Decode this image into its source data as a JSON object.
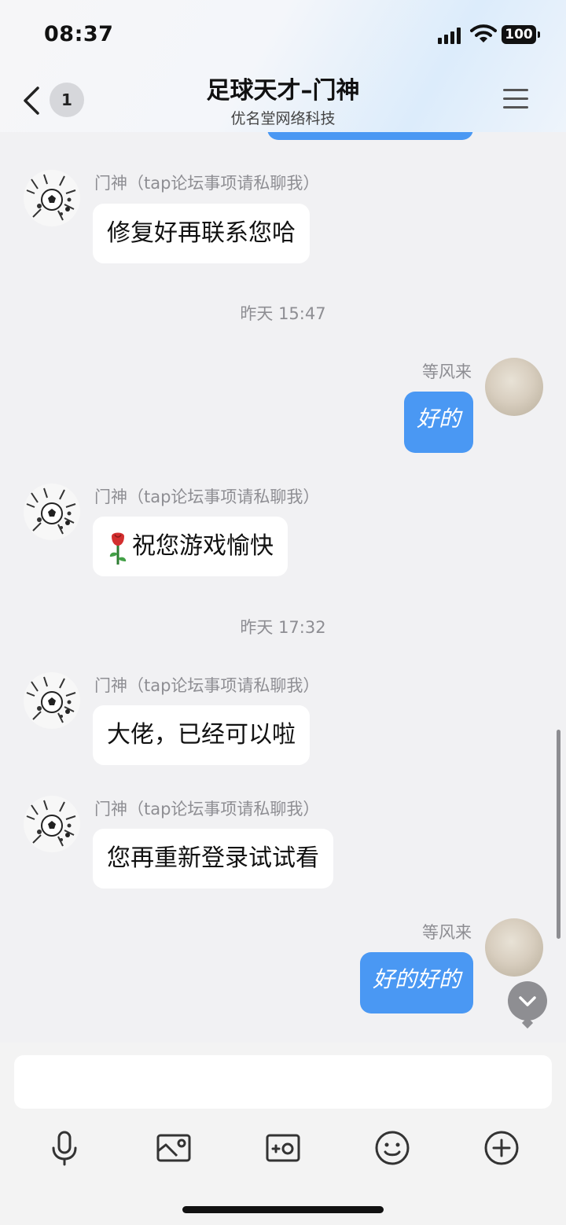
{
  "status_bar": {
    "time": "08:37",
    "battery": "100"
  },
  "header": {
    "back_count": "1",
    "title": "足球天才–门神",
    "subtitle": "优名堂网络科技"
  },
  "messages": [
    {
      "side": "left",
      "sender": "门神（tap论坛事项请私聊我）",
      "text": "修复好再联系您哈"
    },
    {
      "type": "time",
      "text": "昨天 15:47"
    },
    {
      "side": "right",
      "sender": "等风来",
      "text": "好的"
    },
    {
      "side": "left",
      "sender": "门神（tap论坛事项请私聊我）",
      "text": "祝您游戏愉快",
      "emoji": "rose-icon"
    },
    {
      "type": "time",
      "text": "昨天 17:32"
    },
    {
      "side": "left",
      "sender": "门神（tap论坛事项请私聊我）",
      "text": "大佬，已经可以啦"
    },
    {
      "side": "left",
      "sender": "门神（tap论坛事项请私聊我）",
      "text": "您再重新登录试试看"
    },
    {
      "side": "right",
      "sender": "等风来",
      "text": "好的好的"
    }
  ],
  "toolbar": [
    "microphone-icon",
    "image-icon",
    "camera-icon",
    "emoji-icon",
    "plus-icon"
  ],
  "colors": {
    "bubble_right": "#4a98f3",
    "bubble_left": "#ffffff",
    "background": "#f1f1f3"
  }
}
